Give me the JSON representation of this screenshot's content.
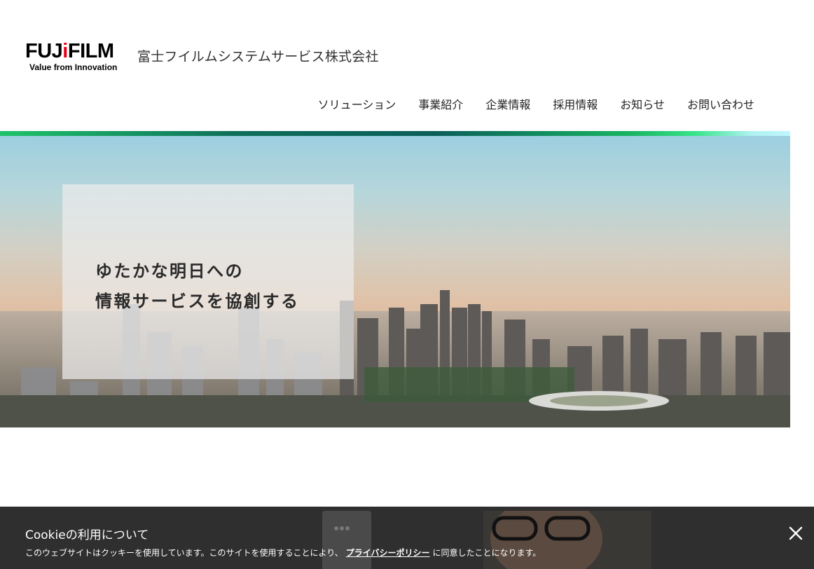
{
  "header": {
    "logo": {
      "brand_prefix": "FUJ",
      "brand_accent": "i",
      "brand_suffix": "FILM",
      "tagline": "Value from Innovation"
    },
    "company_name": "富士フイルムシステムサービス株式会社",
    "nav": [
      {
        "label": "ソリューション"
      },
      {
        "label": "事業紹介"
      },
      {
        "label": "企業情報"
      },
      {
        "label": "採用情報"
      },
      {
        "label": "お知らせ"
      },
      {
        "label": "お問い合わせ"
      }
    ]
  },
  "hero": {
    "line1": "ゆたかな明日への",
    "line2": "情報サービスを協創する"
  },
  "cookie": {
    "title": "Cookieの利用について",
    "text_before": "このウェブサイトはクッキーを使用しています。このサイトを使用することにより、",
    "link": "プライバシーポリシー",
    "text_after": "に同意したことになります。",
    "close_icon": "close-icon"
  },
  "colors": {
    "accent_red": "#e60012",
    "gradient_green": "#1fc36a",
    "gradient_teal": "#0a5f5a",
    "cookie_bg": "#282828"
  }
}
